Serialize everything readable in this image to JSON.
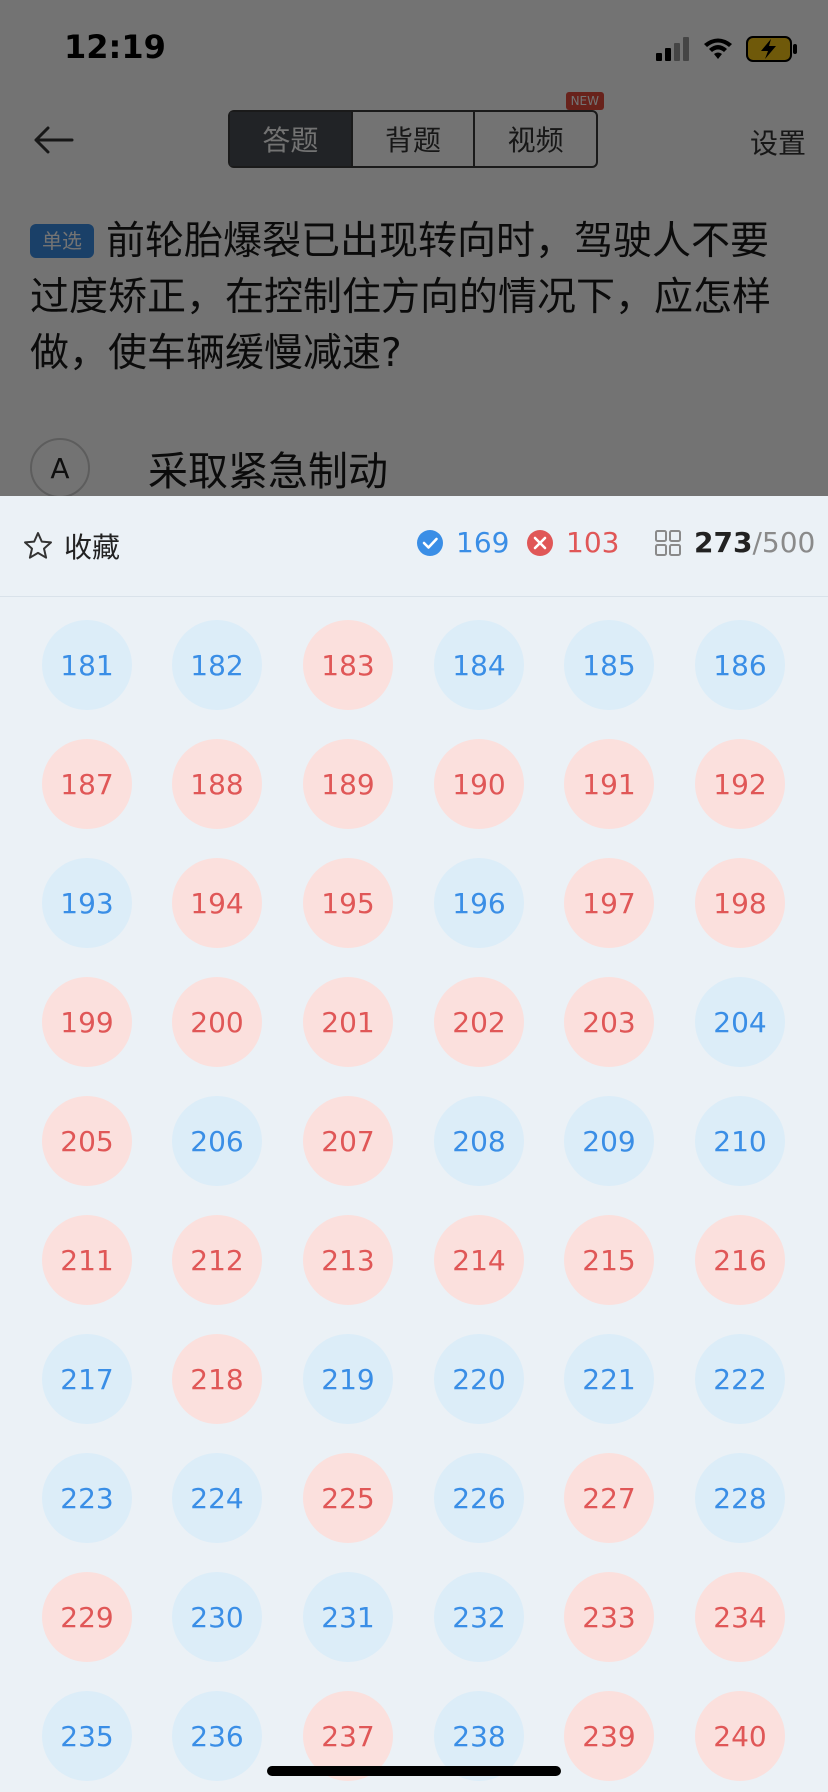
{
  "status_bar": {
    "time": "12:19",
    "icons": [
      "signal-icon",
      "wifi-icon",
      "battery-charging-icon"
    ]
  },
  "nav": {
    "back_icon": "arrow-left-icon",
    "tabs": [
      {
        "label": "答题",
        "active": true
      },
      {
        "label": "背题",
        "active": false
      },
      {
        "label": "视频",
        "active": false,
        "badge": "NEW"
      }
    ],
    "settings_label": "设置"
  },
  "question": {
    "type_badge": "单选",
    "text": "前轮胎爆裂已出现转向时，驾驶人不要过度矫正，在控制住方向的情况下，应怎样做，使车辆缓慢减速?",
    "options": [
      {
        "letter": "A",
        "text": "采取紧急制动"
      }
    ]
  },
  "sheet": {
    "favorite_label": "收藏",
    "correct_count": "169",
    "wrong_count": "103",
    "total_current": "273",
    "total_separator": "/",
    "total_max": "500",
    "colors": {
      "correct": "#3a8ee6",
      "wrong": "#e05757",
      "correct_bg": "#dcedf8",
      "wrong_bg": "#fbe0dd"
    },
    "items": [
      {
        "num": "181",
        "status": "correct"
      },
      {
        "num": "182",
        "status": "correct"
      },
      {
        "num": "183",
        "status": "wrong"
      },
      {
        "num": "184",
        "status": "correct"
      },
      {
        "num": "185",
        "status": "correct"
      },
      {
        "num": "186",
        "status": "correct"
      },
      {
        "num": "187",
        "status": "wrong"
      },
      {
        "num": "188",
        "status": "wrong"
      },
      {
        "num": "189",
        "status": "wrong"
      },
      {
        "num": "190",
        "status": "wrong"
      },
      {
        "num": "191",
        "status": "wrong"
      },
      {
        "num": "192",
        "status": "wrong"
      },
      {
        "num": "193",
        "status": "correct"
      },
      {
        "num": "194",
        "status": "wrong"
      },
      {
        "num": "195",
        "status": "wrong"
      },
      {
        "num": "196",
        "status": "correct"
      },
      {
        "num": "197",
        "status": "wrong"
      },
      {
        "num": "198",
        "status": "wrong"
      },
      {
        "num": "199",
        "status": "wrong"
      },
      {
        "num": "200",
        "status": "wrong"
      },
      {
        "num": "201",
        "status": "wrong"
      },
      {
        "num": "202",
        "status": "wrong"
      },
      {
        "num": "203",
        "status": "wrong"
      },
      {
        "num": "204",
        "status": "correct"
      },
      {
        "num": "205",
        "status": "wrong"
      },
      {
        "num": "206",
        "status": "correct"
      },
      {
        "num": "207",
        "status": "wrong"
      },
      {
        "num": "208",
        "status": "correct"
      },
      {
        "num": "209",
        "status": "correct"
      },
      {
        "num": "210",
        "status": "correct"
      },
      {
        "num": "211",
        "status": "wrong"
      },
      {
        "num": "212",
        "status": "wrong"
      },
      {
        "num": "213",
        "status": "wrong"
      },
      {
        "num": "214",
        "status": "wrong"
      },
      {
        "num": "215",
        "status": "wrong"
      },
      {
        "num": "216",
        "status": "wrong"
      },
      {
        "num": "217",
        "status": "correct"
      },
      {
        "num": "218",
        "status": "wrong"
      },
      {
        "num": "219",
        "status": "correct"
      },
      {
        "num": "220",
        "status": "correct"
      },
      {
        "num": "221",
        "status": "correct"
      },
      {
        "num": "222",
        "status": "correct"
      },
      {
        "num": "223",
        "status": "correct"
      },
      {
        "num": "224",
        "status": "correct"
      },
      {
        "num": "225",
        "status": "wrong"
      },
      {
        "num": "226",
        "status": "correct"
      },
      {
        "num": "227",
        "status": "wrong"
      },
      {
        "num": "228",
        "status": "correct"
      },
      {
        "num": "229",
        "status": "wrong"
      },
      {
        "num": "230",
        "status": "correct"
      },
      {
        "num": "231",
        "status": "correct"
      },
      {
        "num": "232",
        "status": "correct"
      },
      {
        "num": "233",
        "status": "wrong"
      },
      {
        "num": "234",
        "status": "wrong"
      },
      {
        "num": "235",
        "status": "correct"
      },
      {
        "num": "236",
        "status": "correct"
      },
      {
        "num": "237",
        "status": "wrong"
      },
      {
        "num": "238",
        "status": "correct"
      },
      {
        "num": "239",
        "status": "wrong"
      },
      {
        "num": "240",
        "status": "wrong"
      }
    ]
  }
}
